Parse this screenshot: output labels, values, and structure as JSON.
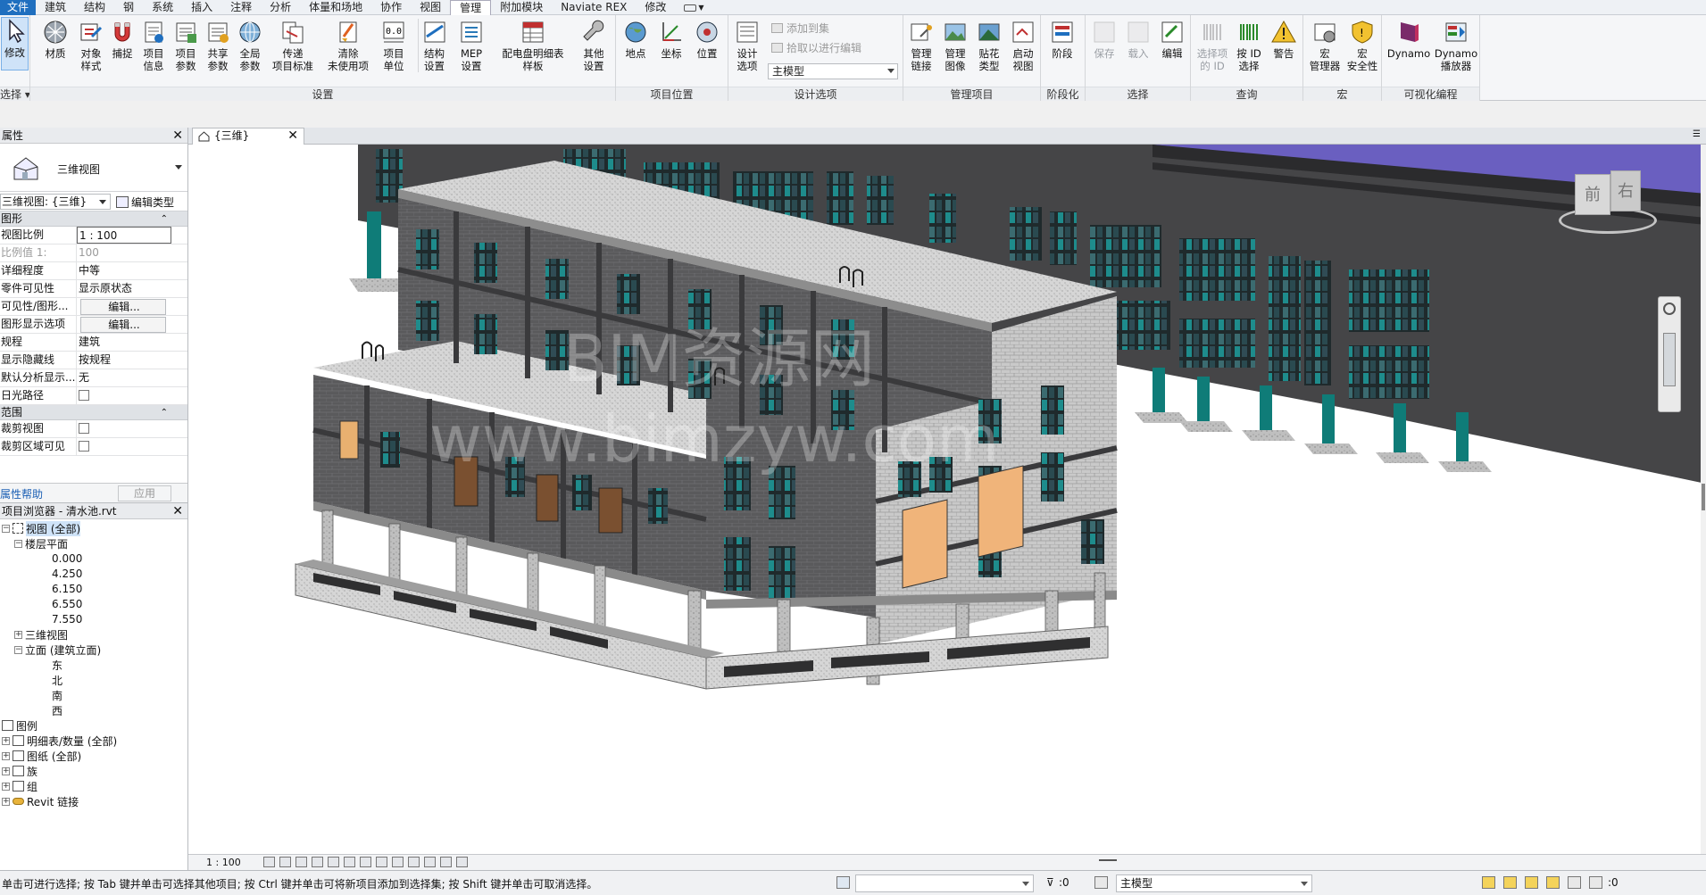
{
  "menu_tabs": [
    "文件",
    "建筑",
    "结构",
    "钢",
    "系统",
    "插入",
    "注释",
    "分析",
    "体量和场地",
    "协作",
    "视图",
    "管理",
    "附加模块",
    "Naviate REX",
    "修改"
  ],
  "active_tab": "管理",
  "ribbon": {
    "panels": [
      {
        "label": "选择",
        "buttons": [
          "修改"
        ]
      },
      {
        "label": "设置",
        "buttons": [
          "材质",
          "对象\n样式",
          "捕捉",
          "项目\n信息",
          "项目\n参数",
          "共享\n参数",
          "全局\n参数",
          "传递\n项目标准",
          "清除\n未使用项",
          "项目\n单位",
          "结构\n设置",
          "MEP\n设置",
          "配电盘明细表\n样板",
          "其他\n设置"
        ]
      },
      {
        "label": "项目位置",
        "buttons": [
          "地点",
          "坐标",
          "位置"
        ]
      },
      {
        "label": "设计选项",
        "buttons": [
          "设计\n选项"
        ],
        "mini": [
          "添加到集",
          "拾取以进行编辑"
        ],
        "combo": "主模型"
      },
      {
        "label": "管理项目",
        "buttons": [
          "管理\n链接",
          "管理\n图像",
          "贴花\n类型",
          "启动\n视图"
        ]
      },
      {
        "label": "阶段化",
        "buttons": [
          "阶段"
        ]
      },
      {
        "label": "选择",
        "buttons": [
          "保存",
          "载入",
          "编辑"
        ]
      },
      {
        "label": "查询",
        "buttons": [
          "选择项\n的 ID",
          "按 ID\n选择",
          "警告"
        ]
      },
      {
        "label": "宏",
        "buttons": [
          "宏\n管理器",
          "宏\n安全性"
        ]
      },
      {
        "label": "可视化编程",
        "buttons": [
          "Dynamo",
          "Dynamo\n播放器"
        ]
      }
    ]
  },
  "properties": {
    "title": "属性",
    "type_name": "三维视图",
    "view_selector": "三维视图: {三维}",
    "edit_type": "编辑类型",
    "section_graphics": "图形",
    "rows": [
      {
        "k": "视图比例",
        "v": "1 : 100"
      },
      {
        "k": "比例值 1:",
        "v": "100"
      },
      {
        "k": "详细程度",
        "v": "中等"
      },
      {
        "k": "零件可见性",
        "v": "显示原状态"
      },
      {
        "k": "可见性/图形...",
        "v": "编辑..."
      },
      {
        "k": "图形显示选项",
        "v": "编辑..."
      },
      {
        "k": "规程",
        "v": "建筑"
      },
      {
        "k": "显示隐藏线",
        "v": "按规程"
      },
      {
        "k": "默认分析显示...",
        "v": "无"
      },
      {
        "k": "日光路径",
        "v": ""
      }
    ],
    "section_range": "范围",
    "range_rows": [
      {
        "k": "裁剪视图",
        "v": ""
      },
      {
        "k": "裁剪区域可见",
        "v": ""
      }
    ],
    "help": "属性帮助",
    "apply": "应用"
  },
  "browser": {
    "title": "项目浏览器 - 清水池.rvt",
    "nodes": [
      "视图 (全部)",
      "楼层平面",
      "0.000",
      "4.250",
      "6.150",
      "6.550",
      "7.550",
      "三维视图",
      "立面 (建筑立面)",
      "东",
      "北",
      "南",
      "西",
      "图例",
      "明细表/数量 (全部)",
      "图纸 (全部)",
      "族",
      "组",
      "Revit 链接"
    ]
  },
  "view_tab": "{三维}",
  "viewcube": {
    "front": "前",
    "right": "右"
  },
  "watermark": {
    "line1": "BIM资源网",
    "line2": "www.bimzyw.com"
  },
  "view_scale": "1 : 100",
  "status": {
    "message": "单击可进行选择; 按 Tab 键并单击可选择其他项目; 按 Ctrl 键并单击可将新项目添加到选择集; 按 Shift 键并单击可取消选择。",
    "count1": ":0",
    "model": "主模型",
    "filter": ":0"
  },
  "colors": {
    "accent": "#1f6fbf",
    "background_canvas": "#ffffff",
    "wall_dark": "#4a4a4c",
    "concrete": "#cfcfcf",
    "door_orange": "#f0b47a"
  }
}
